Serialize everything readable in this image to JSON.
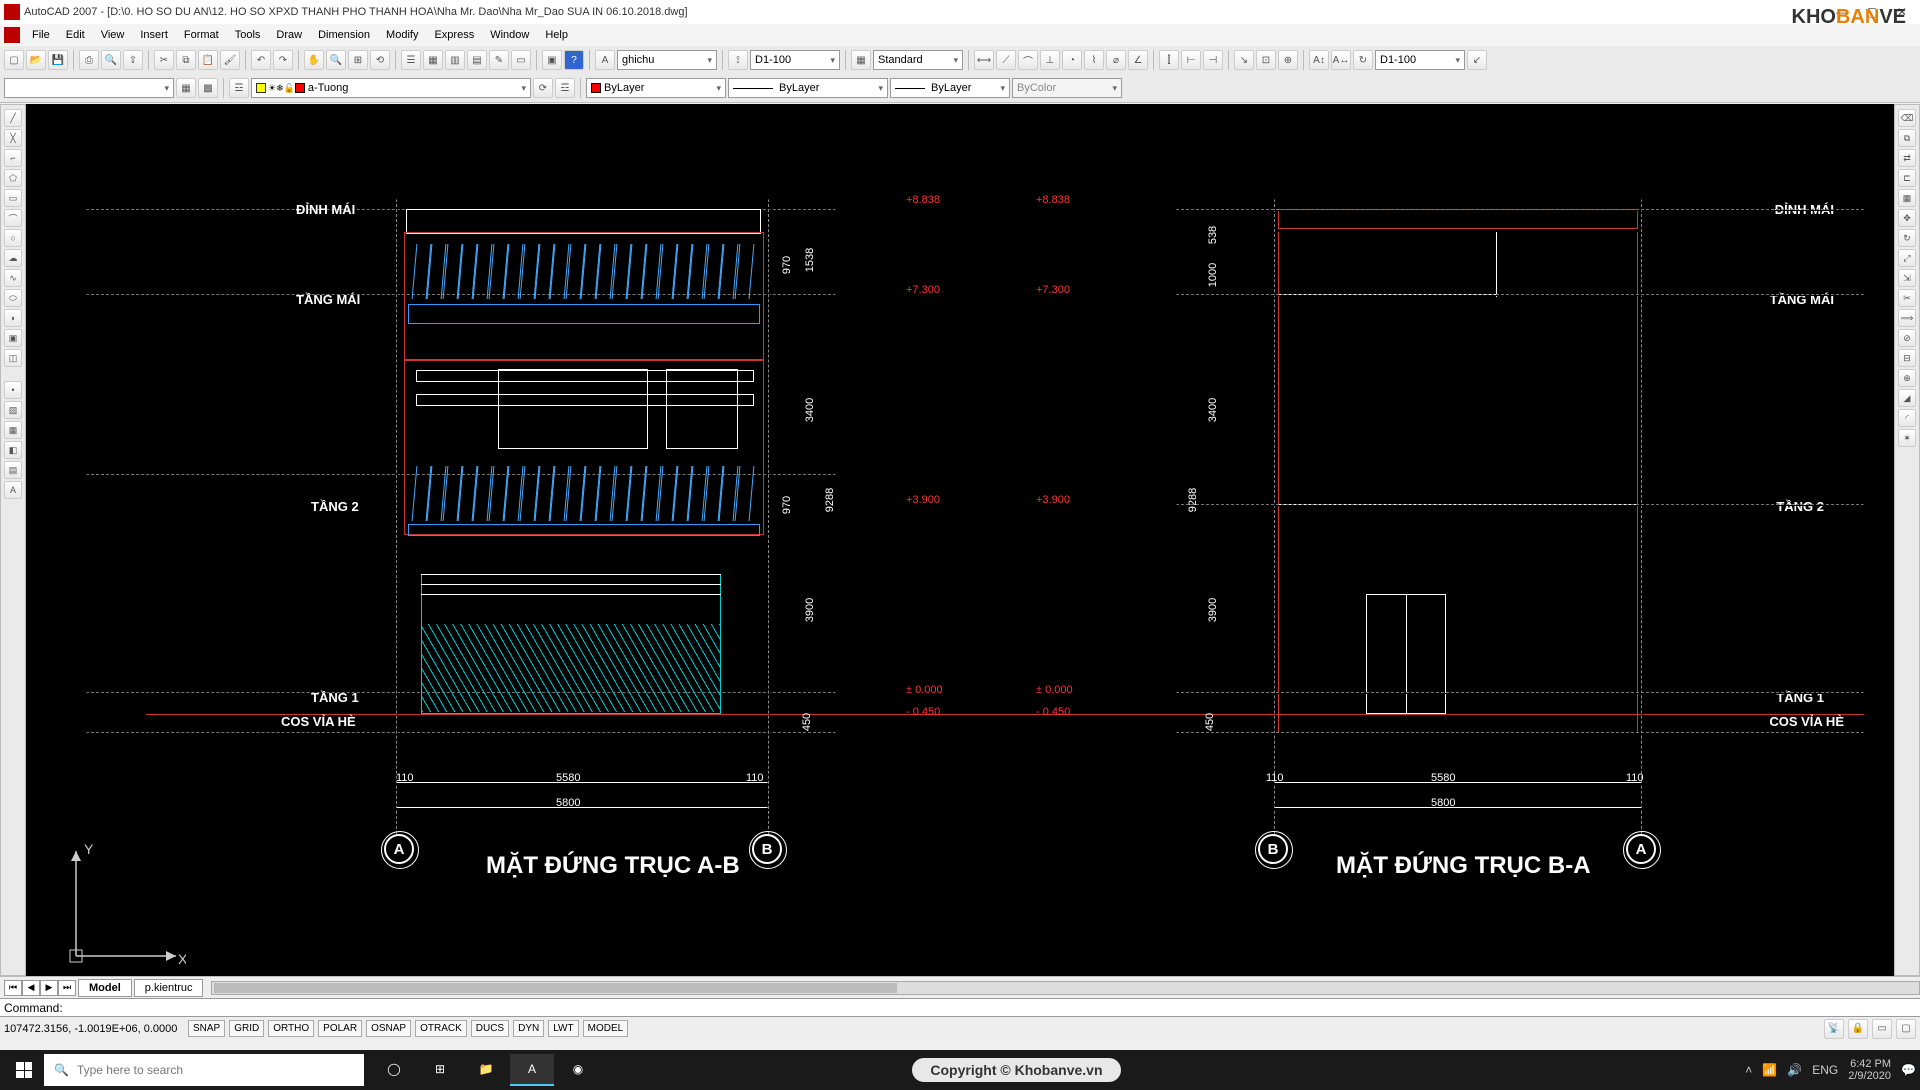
{
  "titlebar": {
    "title": "AutoCAD 2007 - [D:\\0. HO SO DU AN\\12. HO SO XPXD THANH PHO THANH HOA\\Nha Mr. Dao\\Nha Mr_Dao SUA IN 06.10.2018.dwg]"
  },
  "menu": {
    "items": [
      "File",
      "Edit",
      "View",
      "Insert",
      "Format",
      "Tools",
      "Draw",
      "Dimension",
      "Modify",
      "Express",
      "Window",
      "Help"
    ]
  },
  "toolbars": {
    "style_combo": "ghichu",
    "dim_combo": "D1-100",
    "std_combo": "Standard",
    "dim2_combo": "D1-100",
    "layer_combo": "a-Tuong",
    "color_combo": "ByLayer",
    "linetype_combo": "ByLayer",
    "lineweight_combo": "ByLayer",
    "plotstyle_combo": "ByColor",
    "empty_combo": ""
  },
  "drawing": {
    "left_labels": [
      "ĐỈNH MÁI",
      "TẦNG MÁI",
      "TẦNG 2",
      "TẦNG 1",
      "COS VỈA HÈ"
    ],
    "right_labels": [
      "ĐỈNH MÁI",
      "TẦNG MÁI",
      "TẦNG 2",
      "TẦNG 1",
      "COS VỈA HÈ"
    ],
    "dims_v_left": [
      "1538",
      "970",
      "3400",
      "9288",
      "970",
      "3900",
      "450"
    ],
    "dims_v_right": [
      "538",
      "1000",
      "3400",
      "9288",
      "3900",
      "450"
    ],
    "elev_marks": [
      "+8.838",
      "+8.838",
      "+7.300",
      "+7.300",
      "+3.900",
      "+3.900",
      "± 0.000",
      "± 0.000",
      "- 0.450",
      "- 0.450"
    ],
    "dims_h": [
      "110",
      "5580",
      "110",
      "5800",
      "110",
      "5580",
      "110",
      "5800"
    ],
    "bubbles_left": [
      "A",
      "B"
    ],
    "bubbles_right": [
      "B",
      "A"
    ],
    "title_left": "MẶT ĐỨNG TRỤC A-B",
    "title_right": "MẶT ĐỨNG TRỤC B-A"
  },
  "tabs": {
    "model": "Model",
    "layout1": "p.kientruc"
  },
  "cmd": {
    "prompt": "Command:"
  },
  "status": {
    "coords": "107472.3156, -1.0019E+06, 0.0000",
    "toggles": [
      "SNAP",
      "GRID",
      "ORTHO",
      "POLAR",
      "OSNAP",
      "OTRACK",
      "DUCS",
      "DYN",
      "LWT",
      "MODEL"
    ]
  },
  "taskbar": {
    "search_placeholder": "Type here to search",
    "copyright": "Copyright © Khobanve.vn",
    "lang": "ENG",
    "time": "6:42 PM",
    "date": "2/9/2020"
  },
  "watermark": {
    "k": "KHO",
    "b": "BAN",
    "v": "VE"
  }
}
